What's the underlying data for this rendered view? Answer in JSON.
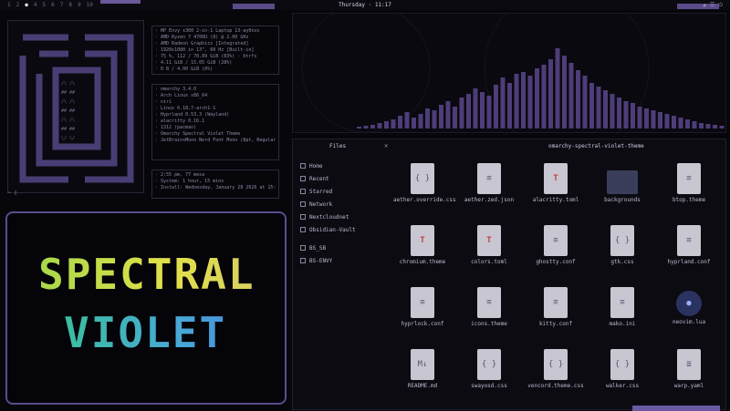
{
  "topbar": {
    "workspaces": [
      "1",
      "2",
      "3",
      "4",
      "5",
      "6",
      "7",
      "8",
      "9",
      "10"
    ],
    "active_workspace": "3",
    "clock": "Thursday · 11:17",
    "tray": [
      "▲",
      "☰",
      "⏻"
    ]
  },
  "terminal": {
    "prompt": "~ ▯"
  },
  "sysinfo": {
    "hw": [
      "HP Envy x360 2-in-1 Laptop 13-ay0xxx",
      "AMD Ryzen 7 4700U (8) @ 2.00 GHz",
      "AMD Radeon Graphics [Integrated]",
      "1920x1080 in 13\", 60 Hz [Built-in]",
      "75 %, 112 / 70.89 GiB (83%) - btrfs",
      "4.11 GiB / 15.05 GiB (28%)",
      "0 B / 4.00 GiB (0%)"
    ],
    "sw": [
      "omarchy 3.4.0",
      "Arch Linux x86_64",
      "niri",
      "Linux 6.18.7-arch1-1",
      "Hyprland 0.53.3 (Wayland)",
      "alacritty 0.16.1",
      "1312 (pacman)",
      "Omarchy Spectral Violet Theme",
      "JetBrainsMono Nerd Font Mono (8pt, Regular)"
    ],
    "uptime": [
      "2:55 pm, 77 mesa",
      "System: 1 hour, 15 mins",
      "Install: Wednesday, January 28 2026 at 15:14"
    ]
  },
  "logo": {
    "line1": "SPECTRAL",
    "line2": "VIOLET"
  },
  "filemanager": {
    "title": "Files",
    "path": "omarchy-spectral-violet-theme",
    "sidebar": [
      "Home",
      "Recent",
      "Starred",
      "Network",
      "Nextcloudnet",
      "Obsidian-Vault",
      "BS_SB",
      "BS-ENVY"
    ],
    "files": [
      {
        "name": "aether.override.css",
        "kind": "code"
      },
      {
        "name": "aether.zed.json",
        "kind": "text"
      },
      {
        "name": "alacritty.toml",
        "kind": "toml"
      },
      {
        "name": "backgrounds",
        "kind": "folder"
      },
      {
        "name": "btop.theme",
        "kind": "text"
      },
      {
        "name": "chromium.theme",
        "kind": "toml"
      },
      {
        "name": "colors.toml",
        "kind": "toml"
      },
      {
        "name": "ghostty.conf",
        "kind": "text"
      },
      {
        "name": "gtk.css",
        "kind": "code"
      },
      {
        "name": "hyprland.conf",
        "kind": "text"
      },
      {
        "name": "hyprlock.conf",
        "kind": "text"
      },
      {
        "name": "icons.theme",
        "kind": "text"
      },
      {
        "name": "kitty.conf",
        "kind": "text"
      },
      {
        "name": "mako.ini",
        "kind": "text"
      },
      {
        "name": "neovim.lua",
        "kind": "lua"
      },
      {
        "name": "README.md",
        "kind": "md"
      },
      {
        "name": "swayosd.css",
        "kind": "code"
      },
      {
        "name": "vencord.theme.css",
        "kind": "code"
      },
      {
        "name": "walker.css",
        "kind": "code"
      },
      {
        "name": "warp.yaml",
        "kind": "yaml"
      }
    ]
  },
  "colors": {
    "accent": "#5b4c8c",
    "bar": "#4e3d78",
    "bg": "#07060b"
  }
}
